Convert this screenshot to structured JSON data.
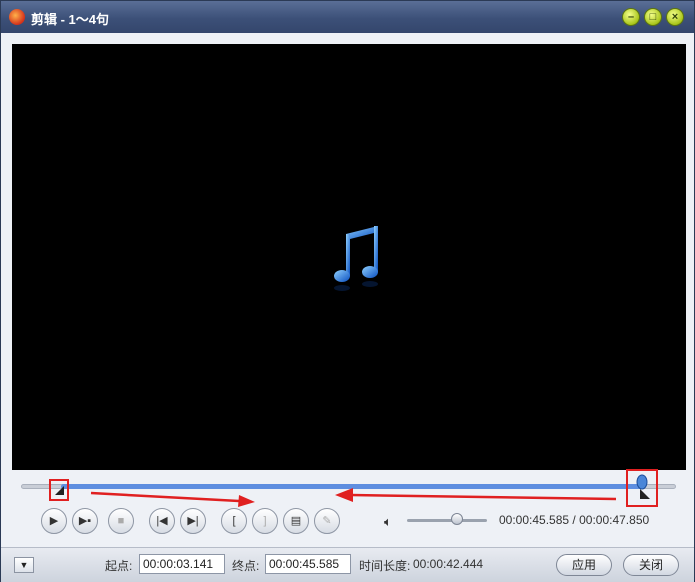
{
  "window": {
    "title": "剪辑 - 1～4句"
  },
  "playback": {
    "current_time": "00:00:45.585",
    "total_time": "00:00:47.850",
    "volume_level": 0.62,
    "selection_start_fraction": 0.066,
    "selection_end_fraction": 0.954
  },
  "bottom": {
    "start_label": "起点:",
    "start_value": "00:00:03.141",
    "end_label": "终点:",
    "end_value": "00:00:45.585",
    "duration_label": "时间长度:",
    "duration_value": "00:00:42.444",
    "apply_label": "应用",
    "close_label": "关闭"
  },
  "icons": [
    "music-note-icon",
    "play-icon",
    "play-selection-icon",
    "stop-icon",
    "prev-icon",
    "next-icon",
    "mark-in-icon",
    "mark-out-icon",
    "add-clip-icon",
    "eraser-icon",
    "volume-icon"
  ],
  "colors": {
    "accent": "#5e8ee0",
    "highlight": "#e02020"
  }
}
